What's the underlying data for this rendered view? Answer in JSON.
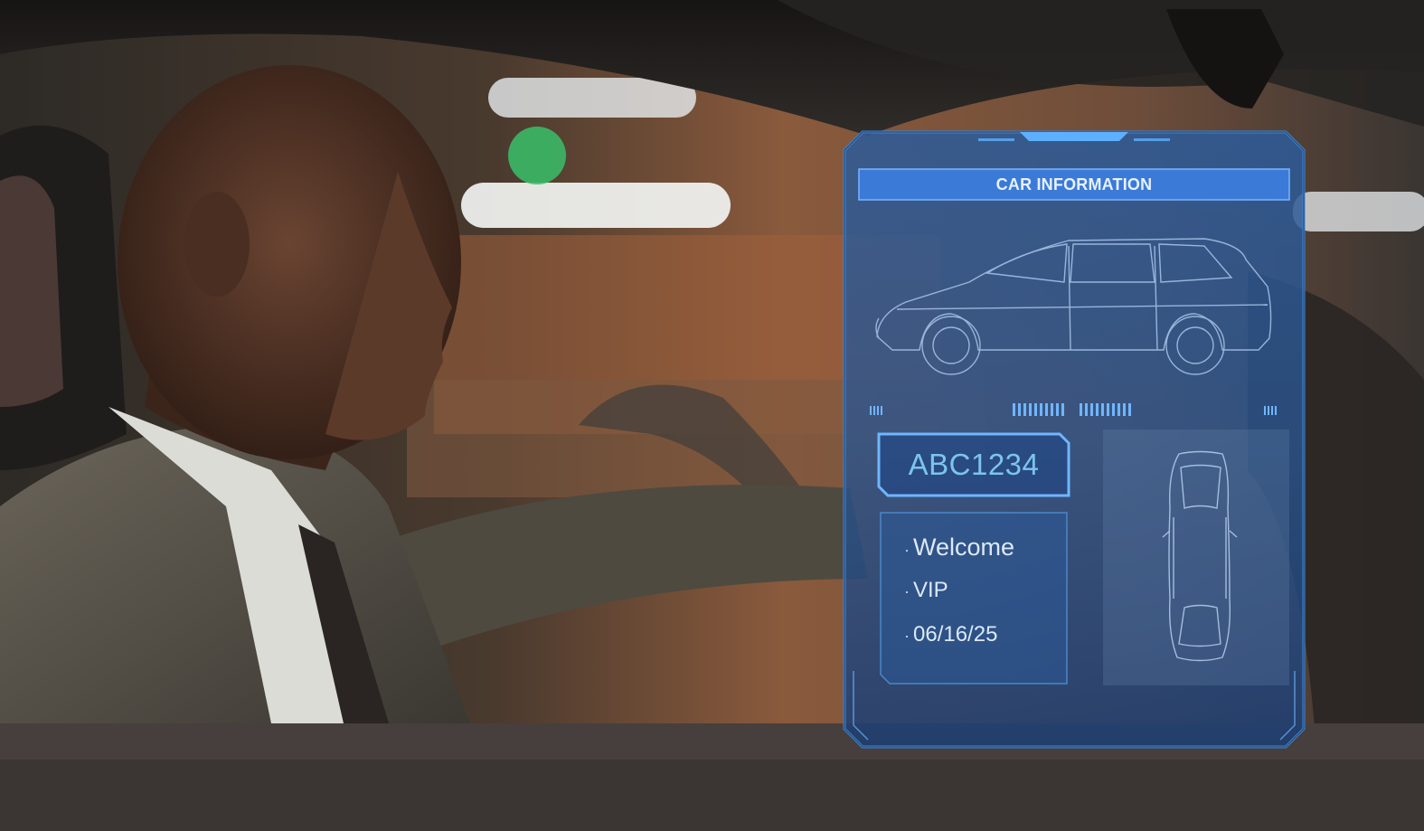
{
  "hud": {
    "title": "CAR INFORMATION",
    "plate": "ABC1234",
    "info_items": [
      "Welcome",
      "VIP",
      "06/16/25"
    ],
    "accent_color": "#5aa8e6",
    "panel_color": "#1f4a86"
  },
  "icons": [
    "car-side-blueprint-icon",
    "car-top-blueprint-icon"
  ]
}
